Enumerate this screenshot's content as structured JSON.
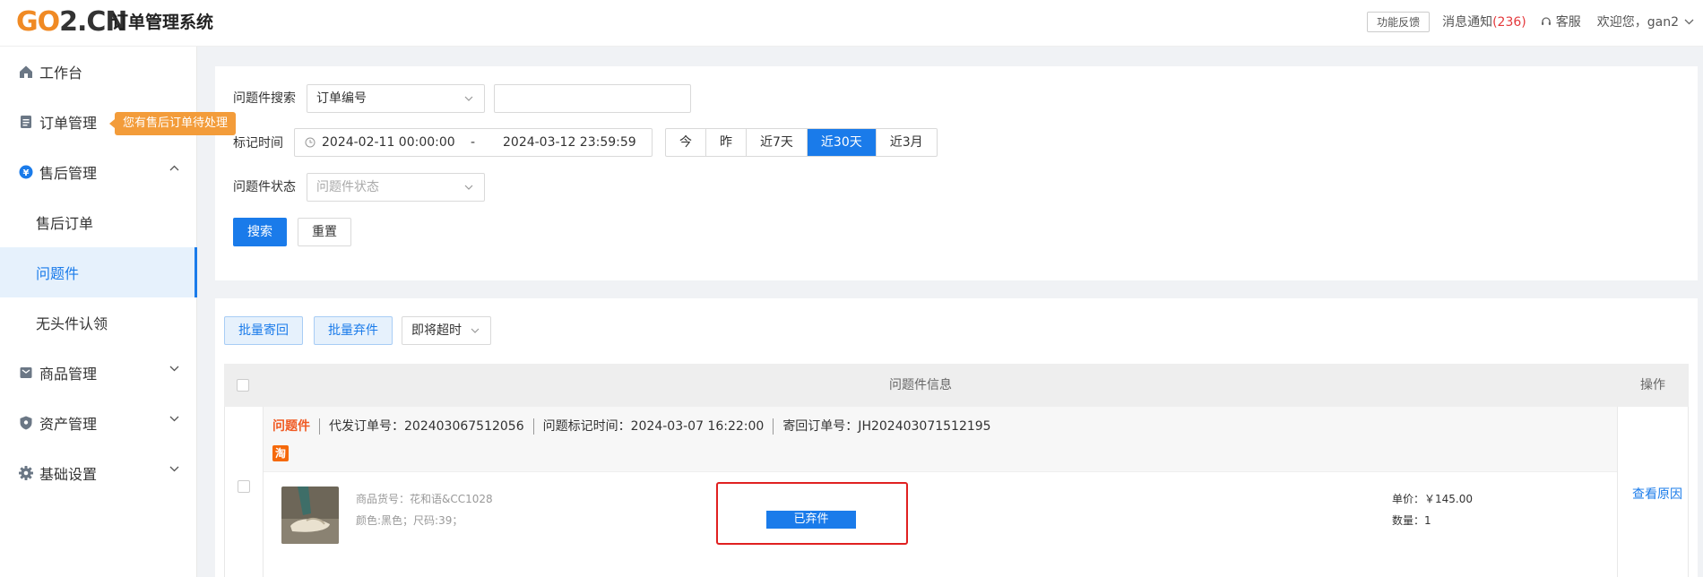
{
  "header": {
    "logo_go": "GO",
    "logo_cn": "2.CN",
    "system_title": "订单管理系统",
    "feedback_button": "功能反馈",
    "messages_label": "消息通知",
    "messages_count": "(236)",
    "service_label": "客服",
    "welcome": "欢迎您，gan2"
  },
  "sidebar": {
    "items": [
      {
        "label": "工作台",
        "icon": "home-icon"
      },
      {
        "label": "订单管理",
        "icon": "order-doc-icon"
      },
      {
        "label": "售后管理",
        "icon": "yen-circle-icon"
      },
      {
        "label": "售后订单"
      },
      {
        "label": "问题件"
      },
      {
        "label": "无头件认领"
      },
      {
        "label": "商品管理",
        "icon": "goods-box-icon"
      },
      {
        "label": "资产管理",
        "icon": "shield-icon"
      },
      {
        "label": "基础设置",
        "icon": "gear-icon"
      }
    ],
    "tooltip": "您有售后订单待处理"
  },
  "filters": {
    "search_label": "问题件搜索",
    "search_type": "订单编号",
    "search_value": "",
    "time_label": "标记时间",
    "date_start": "2024-02-11 00:00:00",
    "date_sep": "-",
    "date_end": "2024-03-12 23:59:59",
    "quick_ranges": [
      "今",
      "昨",
      "近7天",
      "近30天",
      "近3月"
    ],
    "quick_range_selected": "近30天",
    "status_label": "问题件状态",
    "status_placeholder": "问题件状态",
    "search_button": "搜索",
    "reset_button": "重置"
  },
  "list": {
    "batch_return": "批量寄回",
    "batch_abandon": "批量弃件",
    "expiring_select": "即将超时",
    "col_info": "问题件信息",
    "col_action": "操作",
    "rows": [
      {
        "tag": "问题件",
        "order_no": "代发订单号：202403067512056",
        "mark_time": "问题标记时间：2024-03-07 16:22:00",
        "return_no": "寄回订单号：JH202403071512195",
        "platform_badge": "淘",
        "sku": "商品货号：花和语&CC1028",
        "spec": "颜色:黑色；尺码:39；",
        "status": "已弃件",
        "unit_price": "单价：￥145.00",
        "quantity": "数量：1",
        "action": "查看原因"
      }
    ]
  },
  "colors": {
    "primary": "#1a7bea",
    "logo_orange": "#f08a24",
    "tooltip_orange": "#f39c3a",
    "alert_red": "#e02020",
    "tag_orange": "#f05a23"
  }
}
